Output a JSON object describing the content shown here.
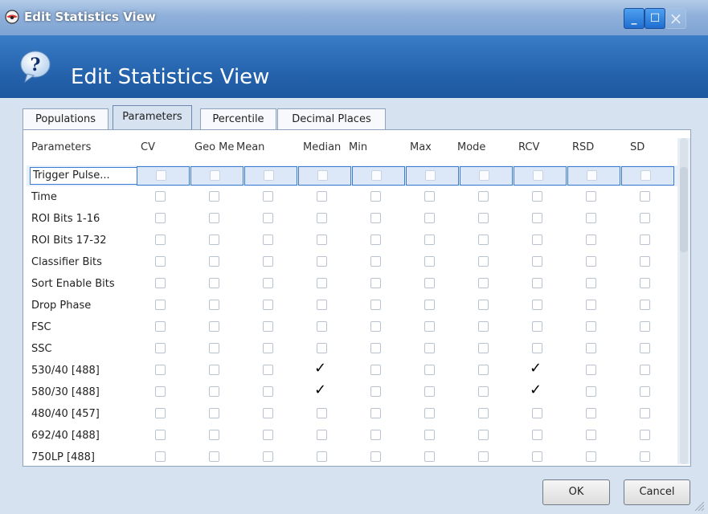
{
  "window": {
    "title": "Edit Statistics View"
  },
  "header": {
    "title": "Edit Statistics View"
  },
  "tabs": [
    "Populations",
    "Parameters",
    "Percentile",
    "Decimal Places"
  ],
  "columns": [
    "Parameters",
    "CV",
    "Geo Me",
    "Mean",
    "Median",
    "Min",
    "Max",
    "Mode",
    "RCV",
    "RSD",
    "SD"
  ],
  "rows": [
    {
      "label": "Trigger Pulse...",
      "checked": []
    },
    {
      "label": "Time",
      "checked": []
    },
    {
      "label": "ROI Bits 1-16",
      "checked": []
    },
    {
      "label": "ROI Bits 17-32",
      "checked": []
    },
    {
      "label": "Classifier Bits",
      "checked": []
    },
    {
      "label": "Sort Enable Bits",
      "checked": []
    },
    {
      "label": "Drop Phase",
      "checked": []
    },
    {
      "label": "FSC",
      "checked": []
    },
    {
      "label": "SSC",
      "checked": []
    },
    {
      "label": "530/40 [488]",
      "checked": [
        "Median",
        "RCV"
      ]
    },
    {
      "label": "580/30 [488]",
      "checked": [
        "Median",
        "RCV"
      ]
    },
    {
      "label": "480/40 [457]",
      "checked": []
    },
    {
      "label": "692/40 [488]",
      "checked": []
    },
    {
      "label": "750LP [488]",
      "checked": []
    }
  ],
  "selected_row": "Trigger Pulse...",
  "buttons": {
    "ok": "OK",
    "cancel": "Cancel"
  },
  "colors": {
    "header_blue": "#2563ad",
    "titlebar_blue": "#8fb0da",
    "selection_border": "#3b7bd1"
  }
}
